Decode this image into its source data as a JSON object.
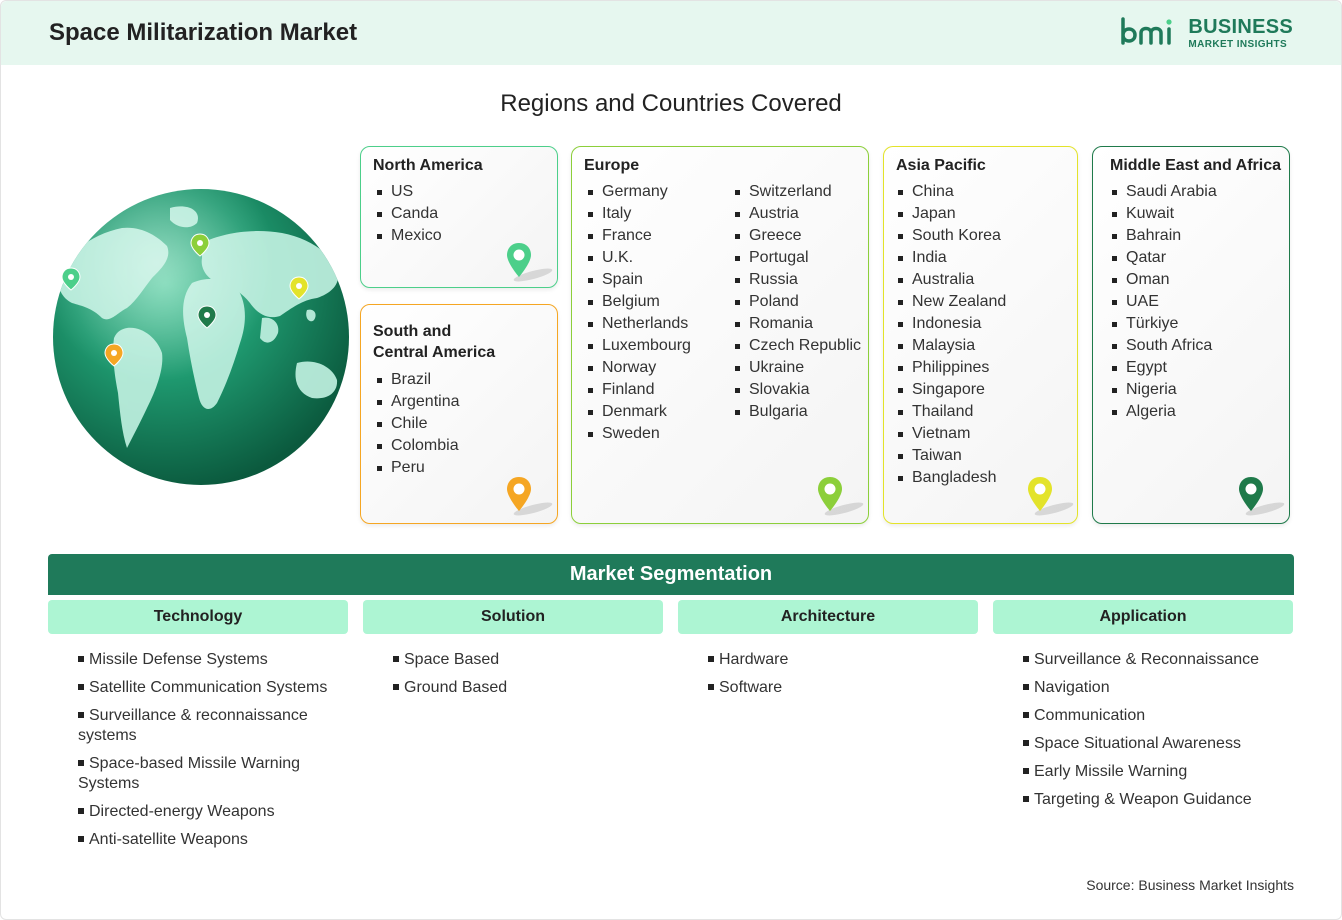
{
  "header": {
    "title": "Space Militarization Market",
    "logo_business": "BUSINESS",
    "logo_subtitle": "MARKET INSIGHTS",
    "logo_mark": "bmi"
  },
  "regions_title": "Regions and Countries Covered",
  "regions": {
    "north_america": {
      "title": "North America",
      "items": [
        "US",
        "Canda",
        "Mexico"
      ],
      "color": "#4ccf8a"
    },
    "south_america": {
      "title_line1": "South and",
      "title_line2": "Central America",
      "items": [
        "Brazil",
        "Argentina",
        "Chile",
        "Colombia",
        "Peru"
      ],
      "color": "#f5a623"
    },
    "europe": {
      "title": "Europe",
      "col1": [
        "Germany",
        "Italy",
        "France",
        "U.K.",
        "Spain",
        "Belgium",
        "Netherlands",
        "Luxembourg",
        "Norway",
        "Finland",
        "Denmark",
        "Sweden"
      ],
      "col2": [
        "Switzerland",
        "Austria",
        "Greece",
        "Portugal",
        "Russia",
        "Poland",
        "Romania",
        "Czech Republic",
        "Ukraine",
        "Slovakia",
        "Bulgaria"
      ],
      "color": "#8ccf3a"
    },
    "asia_pacific": {
      "title": "Asia Pacific",
      "items": [
        "China",
        "Japan",
        "South Korea",
        "India",
        "Australia",
        "New Zealand",
        "Indonesia",
        "Malaysia",
        "Philippines",
        "Singapore",
        "Thailand",
        "Vietnam",
        "Taiwan",
        "Bangladesh"
      ],
      "color": "#e3e32a"
    },
    "mea": {
      "title": "Middle East and Africa",
      "items": [
        "Saudi Arabia",
        "Kuwait",
        "Bahrain",
        "Qatar",
        "Oman",
        "UAE",
        "Türkiye",
        "South Africa",
        "Egypt",
        "Nigeria",
        "Algeria"
      ],
      "color": "#1f7a4a"
    }
  },
  "segmentation": {
    "title": "Market Segmentation",
    "columns": [
      {
        "title": "Technology",
        "items": [
          "Missile Defense Systems",
          "Satellite Communication Systems",
          "Surveillance & reconnaissance systems",
          "Space-based Missile Warning Systems",
          "Directed-energy Weapons",
          "Anti-satellite Weapons"
        ]
      },
      {
        "title": "Solution",
        "items": [
          "Space Based",
          "Ground Based"
        ]
      },
      {
        "title": "Architecture",
        "items": [
          "Hardware",
          "Software"
        ]
      },
      {
        "title": "Application",
        "items": [
          "Surveillance & Reconnaissance",
          "Navigation",
          "Communication",
          "Space Situational Awareness",
          "Early Missile Warning",
          "Targeting & Weapon Guidance"
        ]
      }
    ]
  },
  "source": "Source: Business Market Insights",
  "icons": {
    "globe": "globe-icon",
    "pin": "location-pin-icon"
  }
}
